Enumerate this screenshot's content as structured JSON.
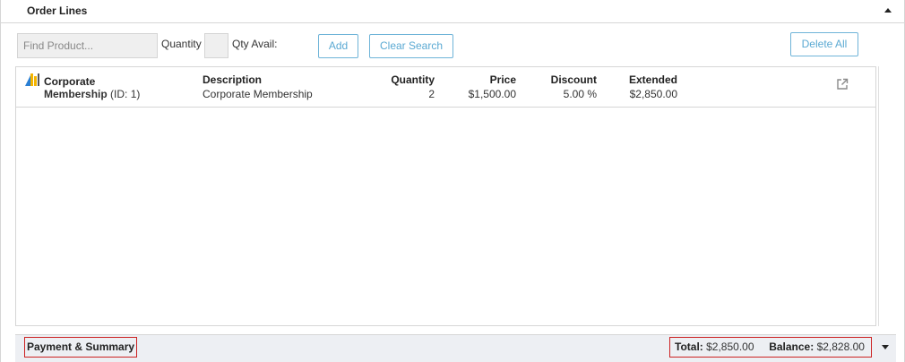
{
  "section": {
    "title": "Order Lines"
  },
  "toolbar": {
    "find_placeholder": "Find Product...",
    "quantity_label": "Quantity",
    "qty_avail_label": "Qty Avail:",
    "add_label": "Add",
    "clear_label": "Clear Search",
    "delete_all_label": "Delete All"
  },
  "lines": [
    {
      "product_name_line1": "Corporate",
      "product_name_line2": "Membership",
      "product_id": "(ID: 1)",
      "description_header": "Description",
      "description": "Corporate Membership",
      "quantity_header": "Quantity",
      "quantity": "2",
      "price_header": "Price",
      "price": "$1,500.00",
      "discount_header": "Discount",
      "discount": "5.00 %",
      "extended_header": "Extended",
      "extended": "$2,850.00"
    }
  ],
  "footer": {
    "title": "Payment & Summary",
    "total_label": "Total:",
    "total_value": "$2,850.00",
    "balance_label": "Balance:",
    "balance_value": "$2,828.00"
  },
  "colors": {
    "button_border": "#6fb4d8",
    "button_text": "#5aa9d3",
    "highlight_box": "#cc2222",
    "footer_bg": "#edeff3"
  },
  "icons": {
    "product": "product-type-icon",
    "open_external": "external-link-icon",
    "collapse": "caret-up-icon",
    "expand": "caret-down-icon"
  }
}
